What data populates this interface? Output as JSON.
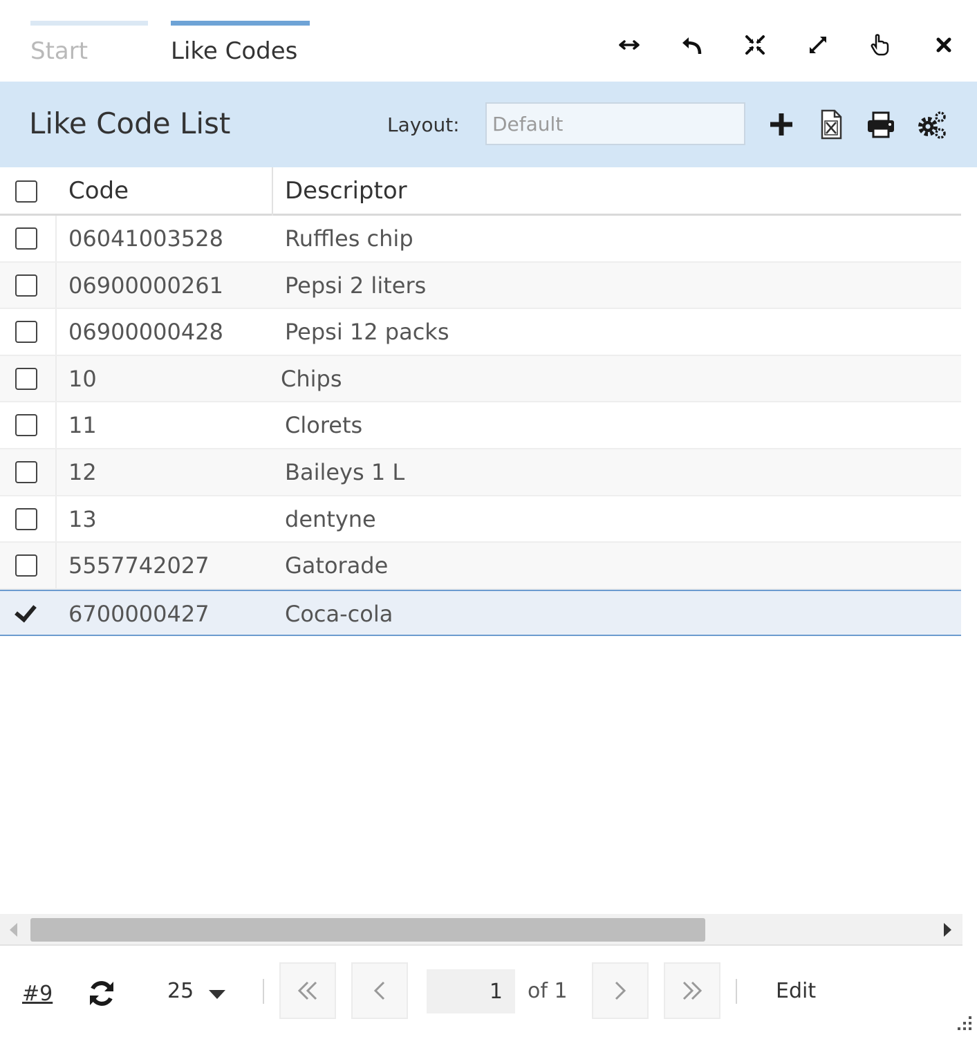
{
  "tabs": [
    {
      "label": "Start",
      "active": false
    },
    {
      "label": "Like Codes",
      "active": true
    }
  ],
  "window_icons": [
    "resize-horizontal-icon",
    "undo-icon",
    "collapse-icon",
    "expand-icon",
    "pointer-icon",
    "close-icon"
  ],
  "header": {
    "title": "Like Code List",
    "layout_label": "Layout:",
    "layout_placeholder": "Default",
    "icons": [
      "add-icon",
      "export-excel-icon",
      "print-icon",
      "settings-icon"
    ]
  },
  "grid": {
    "columns": [
      "Code",
      "Descriptor"
    ],
    "rows": [
      {
        "code": "06041003528",
        "descriptor": "Ruffles chip",
        "checked": false
      },
      {
        "code": "06900000261",
        "descriptor": "Pepsi 2 liters",
        "checked": false
      },
      {
        "code": "06900000428",
        "descriptor": "Pepsi 12 packs",
        "checked": false
      },
      {
        "code": "10",
        "descriptor": "Chips",
        "checked": false
      },
      {
        "code": "11",
        "descriptor": "Clorets",
        "checked": false
      },
      {
        "code": "12",
        "descriptor": "Baileys 1 L",
        "checked": false
      },
      {
        "code": "13",
        "descriptor": "dentyne",
        "checked": false
      },
      {
        "code": "5557742027",
        "descriptor": "Gatorade",
        "checked": false
      },
      {
        "code": "6700000427",
        "descriptor": "Coca-cola",
        "checked": true
      }
    ]
  },
  "footer": {
    "record_count": "#9",
    "page_size": "25",
    "current_page": "1",
    "of_pages": "of 1",
    "edit_label": "Edit"
  },
  "colors": {
    "header_bg": "#d4e6f6",
    "active_tab_bar": "#6ea3d6",
    "selected_row_border": "#6b9bcf"
  }
}
